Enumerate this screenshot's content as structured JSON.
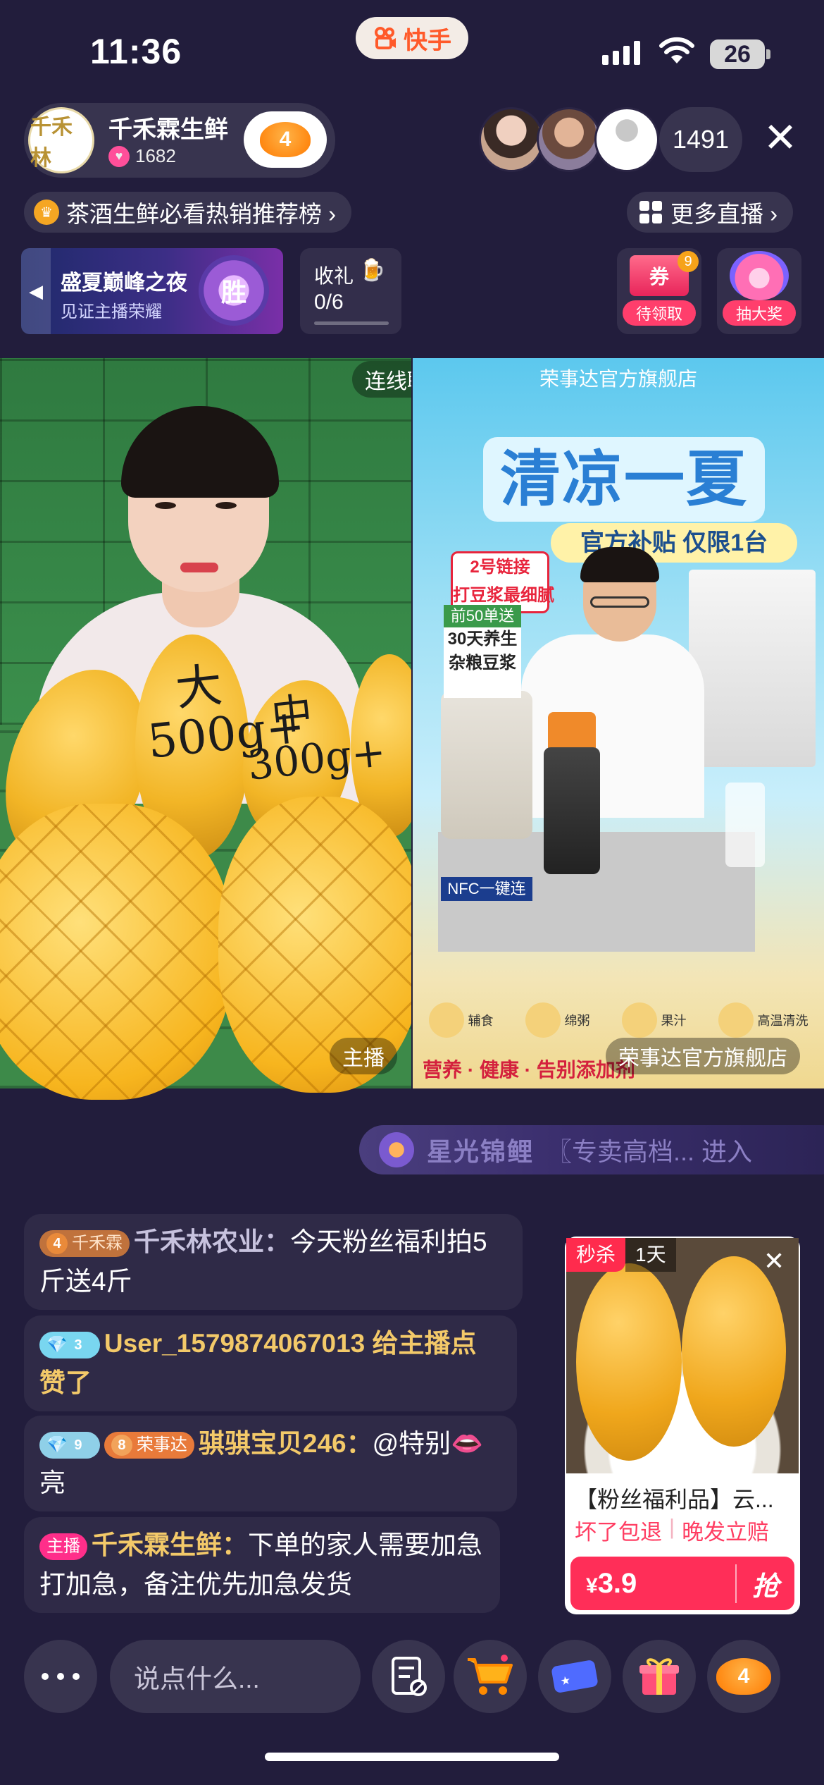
{
  "status_bar": {
    "time": "11:36",
    "app_name": "快手",
    "battery": "26"
  },
  "host": {
    "avatar_text": "千禾林",
    "name": "千禾霖生鲜",
    "likes": "1682",
    "fan_level": "4"
  },
  "viewers": {
    "count": "1491"
  },
  "ranking": {
    "label": "茶酒生鲜必看热销推荐榜 ›"
  },
  "more_live": {
    "label": "更多直播 ›"
  },
  "event": {
    "title": "盛夏巅峰之夜",
    "subtitle": "见证主播荣耀",
    "medal_text": "胜"
  },
  "gift_task": {
    "label": "收礼",
    "progress": "0/6"
  },
  "coupon": {
    "icon_text": "券",
    "count": "9",
    "label": "待领取"
  },
  "lottery": {
    "label": "抽大奖"
  },
  "video_left": {
    "mango_big": "大\n500g+",
    "mango_mid": "中\n300g+",
    "label": "主播",
    "link_chat": "连线聊天"
  },
  "video_right": {
    "store_top": "荣事达官方旗舰店",
    "headline": "清凉一夏",
    "subline": "官方补贴 仅限1台",
    "promo_link": "2号链接\n打豆浆最细腻",
    "promo_first": "前50单送",
    "promo_gift": "30天养生\n杂粮豆浆",
    "nfc": "NFC一键连",
    "features": [
      "辅食",
      "绵粥",
      "果汁",
      "高温清洗"
    ],
    "slogan": "营养 · 健康 · 告别添加剂",
    "label": "荣事达官方旗舰店"
  },
  "fans_banner": {
    "name": "星光锦鲤",
    "text": "〖专卖高档... 进入"
  },
  "comments": [
    {
      "badge": "千禾霖",
      "badge_level": "4",
      "name": "千禾林农业：",
      "text": "今天粉丝福利拍5斤送4斤"
    },
    {
      "badge_level": "3",
      "name": "User_1579874067013",
      "text": " 给主播点赞了"
    },
    {
      "badge_level": "9",
      "badge2_level": "8",
      "badge2": "荣事达",
      "name": "骐骐宝贝246：",
      "text": "@特别👄亮"
    },
    {
      "badge": "主播",
      "name": "千禾霖生鲜：",
      "text": "下单的家人需要加急打加急，备注优先加急发货"
    }
  ],
  "product": {
    "flash_label": "秒杀",
    "duration": "1天",
    "title": "【粉丝福利品】云...",
    "tag1": "坏了包退",
    "tag2": "晚发立赔",
    "currency": "¥",
    "price": "3.9",
    "buy_label": "抢"
  },
  "bottom_bar": {
    "input_placeholder": "说点什么...",
    "fan_level": "4"
  },
  "colors": {
    "background": "#221d3c",
    "accent": "#ff2e58",
    "gold_name": "#f3c969"
  }
}
